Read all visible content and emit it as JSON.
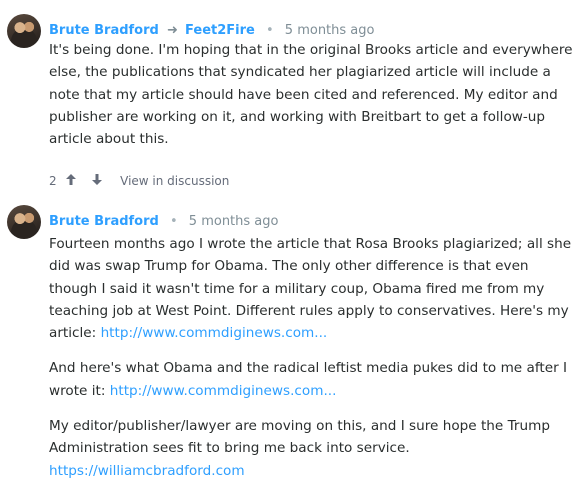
{
  "comments": [
    {
      "author": "Brute Bradford",
      "reply_arrow": "➜",
      "reply_to": "Feet2Fire",
      "separator": "•",
      "time": "5 months ago",
      "paragraphs": [
        "It's being done. I'm hoping that in the original Brooks article and everywhere else, the publications that syndicated her plagiarized article will include a note that my article should have been cited and referenced. My editor and publisher are working on it, and working with Breitbart to get a follow-up article about this."
      ],
      "votes": "2",
      "upvote_icon": "arrow-up-icon",
      "downvote_icon": "arrow-down-icon",
      "view_link": "View in discussion"
    },
    {
      "author": "Brute Bradford",
      "separator": "•",
      "time": "5 months ago",
      "p1_text": "Fourteen months ago I wrote the article that Rosa Brooks plagiarized; all she did was swap Trump for Obama. The only other difference is that even though I said it wasn't time for a military coup, Obama fired me from my teaching job at West Point. Different rules apply to conservatives. Here's my article:",
      "p1_link": "http://www.commdiginews.com...",
      "p2_text": "And here's what Obama and the radical leftist media pukes did to me after I wrote it:",
      "p2_link": "http://www.commdiginews.com...",
      "p3_text": "My editor/publisher/lawyer are moving on this, and I sure hope the Trump Administration sees fit to bring me back into service.",
      "p3_link": "https://williamcbradford.com"
    }
  ],
  "colors": {
    "author_blue": "#2e9fff",
    "meta_gray": "#7f8e96",
    "body_text": "#2a2e2e"
  }
}
